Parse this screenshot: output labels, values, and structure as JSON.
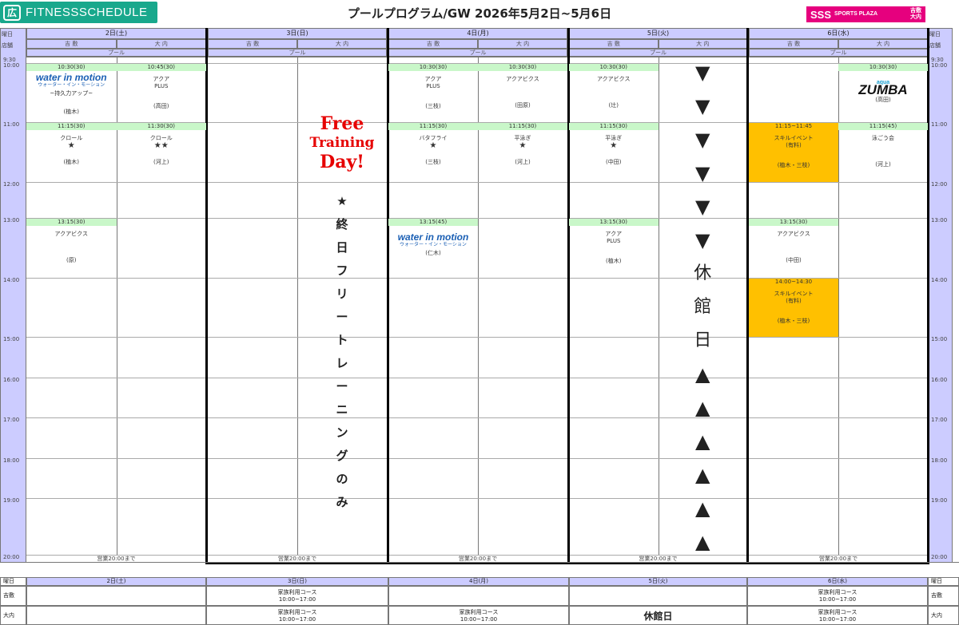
{
  "brand": {
    "name": "FITNESSSCHEDULE",
    "icon": "fitness-logo-icon",
    "color": "#19a88c"
  },
  "title": "プールプログラム/GW 2026年5月2日~5月6日",
  "club_logo": {
    "main": "SSS",
    "sub": "SPORTS PLAZA",
    "branch_top": "吉敷",
    "branch_bottom": "大内",
    "color": "#e6007e"
  },
  "header": {
    "row1": "曜日",
    "row2": "店舗",
    "pool": "プール",
    "right_row1": "曜日",
    "right_row2": "店舗"
  },
  "days": [
    {
      "label": "2日(土)",
      "stores": [
        "吉 敷",
        "大 内"
      ],
      "pool": "プール",
      "footer": "営業20:00まで"
    },
    {
      "label": "3日(日)",
      "stores": [
        "吉 敷",
        "大 内"
      ],
      "pool": "プール",
      "footer": "営業20:00まで"
    },
    {
      "label": "4日(月)",
      "stores": [
        "吉 敷",
        "大 内"
      ],
      "pool": "プール",
      "footer": "営業20:00まで"
    },
    {
      "label": "5日(火)",
      "stores": [
        "吉 敷",
        "大 内"
      ],
      "pool": "プール",
      "footer": "営業20:00まで"
    },
    {
      "label": "6日(水)",
      "stores": [
        "吉 敷",
        "大 内"
      ],
      "pool": "プール",
      "footer": "営業20:00まで"
    }
  ],
  "times": [
    "9:30",
    "10:00",
    "11:00",
    "12:00",
    "13:00",
    "14:00",
    "15:00",
    "16:00",
    "17:00",
    "18:00",
    "19:00",
    "20:00"
  ],
  "slots": {
    "d2_y_1000": {
      "time": "10:30(30)",
      "logo": "water in motion",
      "logo_sub": "ウォーター・イン・モーション",
      "name": "~持久力アップ~",
      "instructor": "(植木)"
    },
    "d2_o_1000": {
      "time": "10:45(30)",
      "name": "アクア",
      "name2": "PLUS",
      "instructor": "(高田)"
    },
    "d2_y_1100": {
      "time": "11:15(30)",
      "name": "クロール",
      "stars": "★",
      "instructor": "(植木)"
    },
    "d2_o_1100": {
      "time": "11:30(30)",
      "name": "クロール",
      "stars": "★★",
      "instructor": "(河上)"
    },
    "d2_y_1300": {
      "time": "13:15(30)",
      "name": "アクアビクス",
      "instructor": "(原)"
    },
    "d4_y_1000": {
      "time": "10:30(30)",
      "name": "アクア",
      "name2": "PLUS",
      "instructor": "(三枝)"
    },
    "d4_o_1000": {
      "time": "10:30(30)",
      "name": "アクアビクス",
      "instructor": "(田原)"
    },
    "d4_y_1100": {
      "time": "11:15(30)",
      "name": "バタフライ",
      "stars": "★",
      "instructor": "(三枝)"
    },
    "d4_o_1100": {
      "time": "11:15(30)",
      "name": "平泳ぎ",
      "stars": "★",
      "instructor": "(河上)"
    },
    "d4_y_1300": {
      "time": "13:15(45)",
      "logo": "water in motion",
      "logo_sub": "ウォーター・イン・モーション",
      "instructor": "(仁木)"
    },
    "d5_y_1000": {
      "time": "10:30(30)",
      "name": "アクアビクス",
      "instructor": "(辻)"
    },
    "d5_y_1100": {
      "time": "11:15(30)",
      "name": "平泳ぎ",
      "stars": "★",
      "instructor": "(中田)"
    },
    "d5_y_1300": {
      "time": "13:15(30)",
      "name": "アクア",
      "name2": "PLUS",
      "instructor": "(植木)"
    },
    "d6_o_1000": {
      "time": "10:30(30)",
      "logo_top": "aqua",
      "logo": "ZUMBA",
      "instructor": "(高田)"
    },
    "d6_y_1100": {
      "time": "11:15~11:45",
      "name": "スキルイベント",
      "name2": "(有料)",
      "instructor": "(植木・三枝)"
    },
    "d6_o_1100": {
      "time": "11:15(45)",
      "name": "泳ごう会",
      "instructor": "(河上)"
    },
    "d6_y_1300": {
      "time": "13:15(30)",
      "name": "アクアビクス",
      "instructor": "(中田)"
    },
    "d6_y_1400": {
      "time": "14:00~14:30",
      "name": "スキルイベント",
      "name2": "(有料)",
      "instructor": "(植木・三枝)"
    }
  },
  "free_day": {
    "line1": "Free",
    "line2": "Training",
    "line3": "Day!",
    "vertical": [
      "★",
      "終",
      "日",
      "フ",
      "リ",
      "ー",
      "ト",
      "レ",
      "ー",
      "ニ",
      "ン",
      "グ",
      "の",
      "み"
    ]
  },
  "closed_day": {
    "down": [
      "▼",
      "▼",
      "▼",
      "▼",
      "▼",
      "▼"
    ],
    "text": [
      "休",
      "館",
      "日"
    ],
    "up": [
      "▲",
      "▲",
      "▲",
      "▲",
      "▲",
      "▲"
    ]
  },
  "bottom": {
    "labels": [
      "曜日",
      "吉敷",
      "大内"
    ],
    "right_labels": [
      "曜日",
      "吉敷",
      "大内"
    ],
    "days": [
      "2日(土)",
      "3日(日)",
      "4日(月)",
      "5日(火)",
      "6日(水)"
    ],
    "yoshiki": [
      "",
      "家族利用コース\n10:00~17:00",
      "",
      "",
      "家族利用コース\n10:00~17:00"
    ],
    "ouchi": [
      "",
      "家族利用コース\n10:00~17:00",
      "家族利用コース\n10:00~17:00",
      "休館日",
      "家族利用コース\n10:00~17:00"
    ]
  },
  "colors": {
    "header": "#ccccff",
    "time_bar": "#c9f7c9",
    "event": "#ffc000",
    "free_red": "#e60000"
  }
}
